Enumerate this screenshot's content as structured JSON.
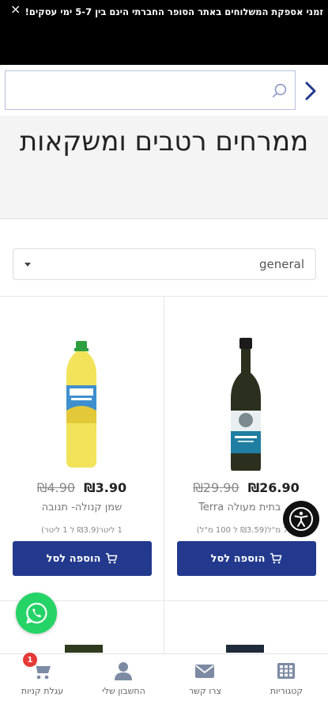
{
  "banner": {
    "close_glyph": "×",
    "text": "זמני אספקת המשלוחים באתר הסופר החברתי הינם בין 5-7 ימי עסקים!"
  },
  "search": {
    "placeholder": ""
  },
  "category": {
    "title": "ממרחים רטבים ומשקאות"
  },
  "sort": {
    "selected": "general"
  },
  "products": [
    {
      "name": "... בתית מעולה Terra",
      "price": "₪26.90",
      "old_price": "₪29.90",
      "unit_price": "7.5 מ\"ל(₪3.59 ל 100 מ\"ל)",
      "button_label": "הוספה לסל",
      "image_icon": "olive-oil-bottle"
    },
    {
      "name": "שמן קנולה- תנובה",
      "price": "₪3.90",
      "old_price": "₪4.90",
      "unit_price": "1 ליטר(₪3.9 ל 1 ליטר)",
      "button_label": "הוספה לסל",
      "image_icon": "canola-oil-bottle"
    }
  ],
  "bottom_nav": {
    "categories": "קטגוריות",
    "contact": "צרו קשר",
    "account": "החשבון שלי",
    "cart": "עגלת קניות",
    "cart_count": "1"
  },
  "colors": {
    "primary": "#22398d",
    "whatsapp": "#25d366",
    "badge": "#e53935",
    "banner": "#000000"
  }
}
